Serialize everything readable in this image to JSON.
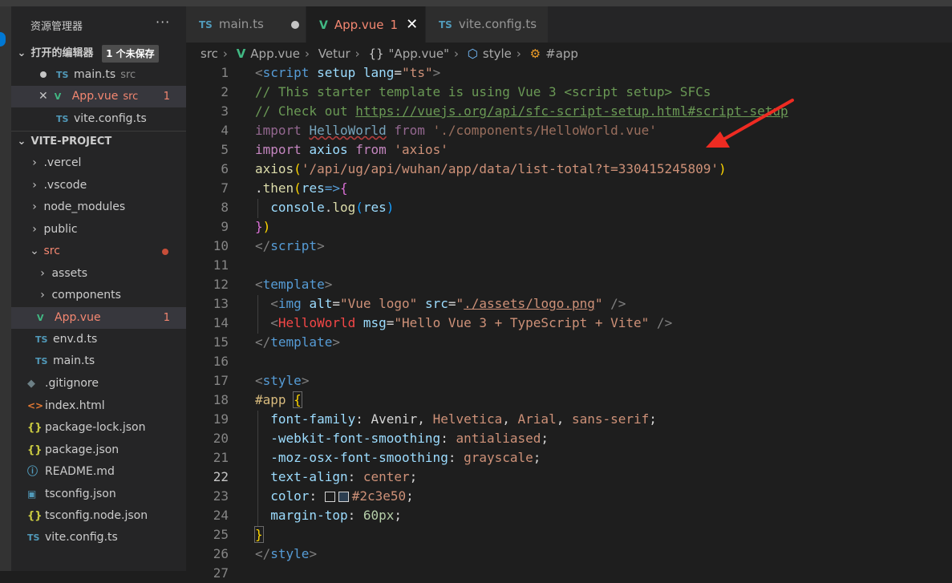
{
  "explorer": {
    "title": "资源管理器",
    "more": "···",
    "open_editors": {
      "header": "打开的编辑器",
      "badge": "1 个未保存",
      "items": [
        {
          "name": "main.ts",
          "sub": "src",
          "icon": "TS"
        },
        {
          "name": "App.vue",
          "sub": "src",
          "count": "1",
          "icon": "V"
        },
        {
          "name": "vite.config.ts",
          "icon": "TS"
        }
      ]
    },
    "project": {
      "header": "VITE-PROJECT",
      "items": [
        {
          "name": ".vercel"
        },
        {
          "name": ".vscode"
        },
        {
          "name": "node_modules"
        },
        {
          "name": "public"
        },
        {
          "name": "src"
        },
        {
          "name": "assets"
        },
        {
          "name": "components"
        },
        {
          "name": "App.vue",
          "count": "1",
          "icon": "V"
        },
        {
          "name": "env.d.ts",
          "icon": "TS"
        },
        {
          "name": "main.ts",
          "icon": "TS"
        },
        {
          "name": ".gitignore",
          "icon": "◆"
        },
        {
          "name": "index.html",
          "icon": "<>"
        },
        {
          "name": "package-lock.json",
          "icon": "{}"
        },
        {
          "name": "package.json",
          "icon": "{}"
        },
        {
          "name": "README.md",
          "icon": "ⓘ"
        },
        {
          "name": "tsconfig.json",
          "icon": "▣"
        },
        {
          "name": "tsconfig.node.json",
          "icon": "{}"
        },
        {
          "name": "vite.config.ts",
          "icon": "TS"
        }
      ]
    }
  },
  "tabs": [
    {
      "label": "main.ts",
      "icon": "TS"
    },
    {
      "label": "App.vue",
      "count": "1",
      "icon": "V"
    },
    {
      "label": "vite.config.ts",
      "icon": "TS"
    }
  ],
  "breadcrumb": [
    "src",
    "App.vue",
    "Vetur",
    "\"App.vue\"",
    "style",
    "#app"
  ],
  "line_numbers": [
    "1",
    "2",
    "3",
    "4",
    "5",
    "6",
    "7",
    "8",
    "9",
    "10",
    "11",
    "12",
    "13",
    "14",
    "15",
    "16",
    "17",
    "18",
    "19",
    "20",
    "21",
    "22",
    "23",
    "24",
    "25",
    "26",
    "27"
  ],
  "current_line": "22",
  "code": {
    "l1": {
      "a": "<",
      "b": "script",
      "c": " ",
      "d": "setup",
      "e": " lang",
      "f": "=",
      "g": "\"ts\"",
      "h": ">"
    },
    "l2": "// This starter template is using Vue 3 <script setup> SFCs",
    "l3": {
      "a": "// Check out ",
      "b": "https://vuejs.org/api/sfc-script-setup.html#script-setup"
    },
    "l4": {
      "a": "import",
      "b": " ",
      "c": "HelloWorld",
      "d": " ",
      "e": "from",
      "f": " './components/HelloWorld.vue'"
    },
    "l5": {
      "a": "import",
      "b": " ",
      "c": "axios",
      "d": " ",
      "e": "from",
      "f": " 'axios'"
    },
    "l6": {
      "a": "axios",
      "b": "(",
      "c": "'/api/ug/api/wuhan/app/data/list-total?t=330415245809'",
      "d": ")"
    },
    "l7": {
      "a": ".",
      "b": "then",
      "c": "(",
      "d": "res",
      "e": "=>",
      "f": "{"
    },
    "l8": {
      "a": "  ",
      "b": "console",
      "c": ".",
      "d": "log",
      "e": "(",
      "f": "res",
      "g": ")"
    },
    "l9": {
      "a": "}",
      "b": ")"
    },
    "l10": {
      "a": "</",
      "b": "script",
      "c": ">"
    },
    "l12": {
      "a": "<",
      "b": "template",
      "c": ">"
    },
    "l13": {
      "a": "  <",
      "b": "img",
      "c": " alt",
      "d": "=",
      "e": "\"Vue logo\"",
      "f": " src",
      "g": "=",
      "h": "\"",
      "i": "./assets/logo.png",
      "j": "\"",
      "k": " />"
    },
    "l14": {
      "a": "  <",
      "b": "HelloWorld",
      "c": " msg",
      "d": "=",
      "e": "\"Hello Vue 3 + TypeScript + Vite\"",
      "f": " />"
    },
    "l15": {
      "a": "</",
      "b": "template",
      "c": ">"
    },
    "l17": {
      "a": "<",
      "b": "style",
      "c": ">"
    },
    "l18": {
      "a": "#app",
      "b": " ",
      "c": "{"
    },
    "l19": {
      "a": "  font-family",
      "b": ": Avenir, ",
      "c": "Helvetica",
      "d": ", ",
      "e": "Arial",
      "f": ", ",
      "g": "sans-serif",
      "h": ";"
    },
    "l20": {
      "a": "  -webkit-font-smoothing",
      "b": ": ",
      "c": "antialiased",
      "d": ";"
    },
    "l21": {
      "a": "  -moz-osx-font-smoothing",
      "b": ": ",
      "c": "grayscale",
      "d": ";"
    },
    "l22": {
      "a": "  text-align",
      "b": ": ",
      "c": "center",
      "d": ";"
    },
    "l23": {
      "a": "  color",
      "b": ": ",
      "c": "#2c3e50",
      "d": ";"
    },
    "l24": {
      "a": "  margin-top",
      "b": ": ",
      "c": "60px",
      "d": ";"
    },
    "l25": "}",
    "l26": {
      "a": "</",
      "b": "style",
      "c": ">"
    }
  },
  "colors": {
    "annotation_arrow": "#ee2b22",
    "accent": "#0078d4"
  }
}
